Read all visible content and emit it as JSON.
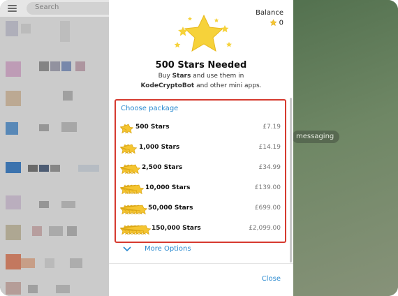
{
  "search": {
    "placeholder": "Search"
  },
  "background": {
    "pill_text": "messaging"
  },
  "modal": {
    "balance_label": "Balance",
    "balance_value": "0",
    "title": "500 Stars Needed",
    "desc_line1_prefix": "Buy ",
    "desc_line1_bold": "Stars",
    "desc_line1_suffix": " and use them in",
    "desc_line2_bold": "KodeCryptoBot",
    "desc_line2_suffix": " and other mini apps.",
    "choose_label": "Choose package",
    "packages": [
      {
        "name": "500 Stars",
        "price": "£7.19"
      },
      {
        "name": "1,000 Stars",
        "price": "£14.19"
      },
      {
        "name": "2,500 Stars",
        "price": "£34.99"
      },
      {
        "name": "10,000 Stars",
        "price": "£139.00"
      },
      {
        "name": "50,000 Stars",
        "price": "£699.00"
      },
      {
        "name": "150,000 Stars",
        "price": "£2,099.00"
      }
    ],
    "more_options": "More Options",
    "close": "Close"
  },
  "colors": {
    "accent": "#2a8ad0",
    "highlight_border": "#d63a2f",
    "star": "#f5c531"
  },
  "icons": [
    "menu-icon",
    "star-icon",
    "chevron-down-icon"
  ]
}
